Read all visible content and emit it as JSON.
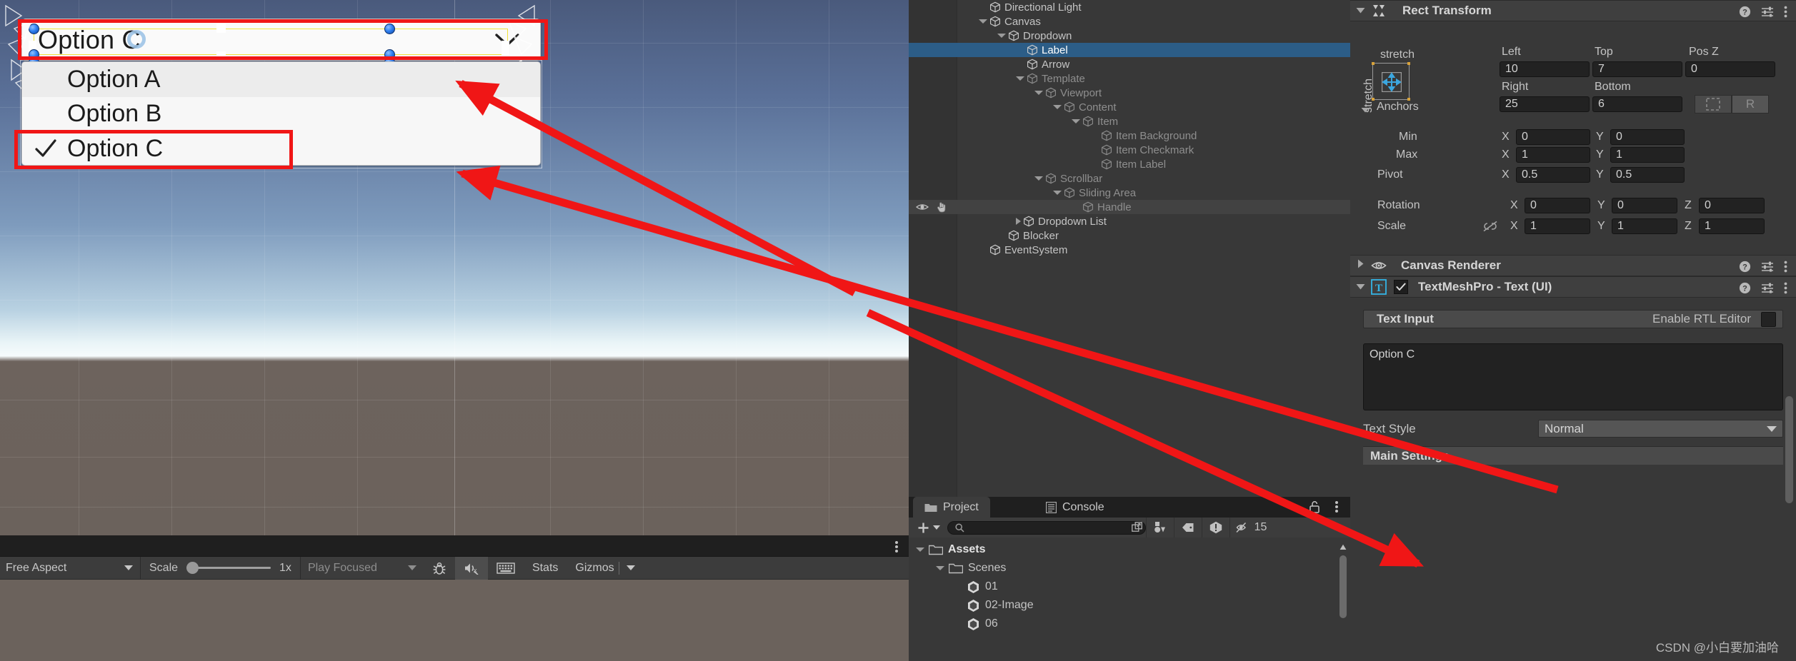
{
  "game_view": {
    "dropdown": {
      "selected_label": "Option C",
      "arrow_icon": "chevron-down-icon",
      "items": [
        {
          "label": "Option A",
          "checked": false
        },
        {
          "label": "Option B",
          "checked": false
        },
        {
          "label": "Option C",
          "checked": true
        }
      ]
    },
    "toolbar": {
      "aspect_label": "Free Aspect",
      "scale_label": "Scale",
      "scale_value": "1x",
      "play_mode_label": "Play Focused",
      "stats_label": "Stats",
      "gizmos_label": "Gizmos",
      "mute_icon": "mute-audio-icon",
      "debug_icon": "bug-icon",
      "keyboard_icon": "keyboard-icon",
      "kebab_icon": "kebab-menu-icon"
    }
  },
  "hierarchy": {
    "rows": [
      {
        "label": "Directional Light",
        "indent": 1,
        "toggle": "none",
        "dim": false,
        "state": "normal"
      },
      {
        "label": "Canvas",
        "indent": 1,
        "toggle": "open",
        "dim": false,
        "state": "normal"
      },
      {
        "label": "Dropdown",
        "indent": 2,
        "toggle": "open",
        "dim": false,
        "state": "normal"
      },
      {
        "label": "Label",
        "indent": 3,
        "toggle": "none",
        "dim": false,
        "state": "selected"
      },
      {
        "label": "Arrow",
        "indent": 3,
        "toggle": "none",
        "dim": false,
        "state": "normal"
      },
      {
        "label": "Template",
        "indent": 3,
        "toggle": "open",
        "dim": true,
        "state": "normal"
      },
      {
        "label": "Viewport",
        "indent": 4,
        "toggle": "open",
        "dim": true,
        "state": "normal"
      },
      {
        "label": "Content",
        "indent": 5,
        "toggle": "open",
        "dim": true,
        "state": "normal"
      },
      {
        "label": "Item",
        "indent": 6,
        "toggle": "open",
        "dim": true,
        "state": "normal"
      },
      {
        "label": "Item Background",
        "indent": 7,
        "toggle": "none",
        "dim": true,
        "state": "normal"
      },
      {
        "label": "Item Checkmark",
        "indent": 7,
        "toggle": "none",
        "dim": true,
        "state": "normal"
      },
      {
        "label": "Item Label",
        "indent": 7,
        "toggle": "none",
        "dim": true,
        "state": "normal"
      },
      {
        "label": "Scrollbar",
        "indent": 4,
        "toggle": "open",
        "dim": true,
        "state": "normal"
      },
      {
        "label": "Sliding Area",
        "indent": 5,
        "toggle": "open",
        "dim": true,
        "state": "normal"
      },
      {
        "label": "Handle",
        "indent": 6,
        "toggle": "none",
        "dim": true,
        "state": "hovered"
      },
      {
        "label": "Dropdown List",
        "indent": 3,
        "toggle": "closed",
        "dim": false,
        "state": "normal"
      },
      {
        "label": "Blocker",
        "indent": 2,
        "toggle": "none",
        "dim": false,
        "state": "normal"
      },
      {
        "label": "EventSystem",
        "indent": 1,
        "toggle": "none",
        "dim": false,
        "state": "normal"
      }
    ],
    "hovered_row_icons": {
      "eye": "eye-icon",
      "hand": "hand-pointer-icon"
    }
  },
  "project": {
    "tabs": [
      {
        "label": "Project",
        "icon": "folder-icon",
        "active": true
      },
      {
        "label": "Console",
        "icon": "console-icon",
        "active": false
      }
    ],
    "lock_icon": "lock-open-icon",
    "kebab_icon": "kebab-menu-icon",
    "add_label": "+",
    "search_placeholder": "",
    "search_value": "",
    "search_icon": "search-icon",
    "tool_icons": [
      "open-in-new-icon",
      "asset-filter-icon",
      "label-filter-icon",
      "warning-filter-icon",
      "hidden-count-icon"
    ],
    "hidden_count": "15",
    "tree": [
      {
        "label": "Assets",
        "indent": 0,
        "toggle": "open",
        "icon": "folder-open-icon",
        "bold": true
      },
      {
        "label": "Scenes",
        "indent": 1,
        "toggle": "open",
        "icon": "folder-open-icon",
        "bold": false
      },
      {
        "label": "01",
        "indent": 2,
        "toggle": "none",
        "icon": "unity-scene-icon",
        "bold": false
      },
      {
        "label": "02-Image",
        "indent": 2,
        "toggle": "none",
        "icon": "unity-scene-icon",
        "bold": false
      },
      {
        "label": "06",
        "indent": 2,
        "toggle": "none",
        "icon": "unity-scene-icon",
        "bold": false
      }
    ]
  },
  "inspector": {
    "rect_transform": {
      "title": "Rect Transform",
      "icon": "rect-transform-icon",
      "help_icon": "help-icon",
      "preset_icon": "preset-icon",
      "kebab_icon": "kebab-menu-icon",
      "anchor_preset_label": "stretch",
      "anchor_preset_label_vertical": "stretch",
      "left_label": "Left",
      "left_value": "10",
      "top_label": "Top",
      "top_value": "7",
      "posz_label": "Pos Z",
      "posz_value": "0",
      "right_label": "Right",
      "right_value": "25",
      "bottom_label": "Bottom",
      "bottom_value": "6",
      "blueprint_icon": "blueprint-mode-icon",
      "raw_edit_label": "R",
      "anchors_label": "Anchors",
      "min_label": "Min",
      "min_x": "0",
      "min_y": "0",
      "max_label": "Max",
      "max_x": "1",
      "max_y": "1",
      "pivot_label": "Pivot",
      "pivot_x": "0.5",
      "pivot_y": "0.5",
      "rotation_label": "Rotation",
      "rot_x": "0",
      "rot_y": "0",
      "rot_z": "0",
      "scale_label": "Scale",
      "scale_link_icon": "link-off-icon",
      "scale_x": "1",
      "scale_y": "1",
      "scale_z": "1",
      "x_axis": "X",
      "y_axis": "Y",
      "z_axis": "Z"
    },
    "canvas_renderer": {
      "title": "Canvas Renderer",
      "eye_icon": "eye-icon",
      "help_icon": "help-icon",
      "preset_icon": "preset-icon",
      "kebab_icon": "kebab-menu-icon"
    },
    "tmp_text": {
      "title": "TextMeshPro - Text (UI)",
      "component_icon": "tmp-text-icon",
      "enabled": true,
      "help_icon": "help-icon",
      "preset_icon": "preset-icon",
      "kebab_icon": "kebab-menu-icon",
      "text_input_label": "Text Input",
      "rtl_label": "Enable RTL Editor",
      "rtl_checked": false,
      "text_value": "Option C",
      "text_style_label": "Text Style",
      "text_style_value": "Normal",
      "main_settings_label": "Main Settings"
    }
  },
  "watermark": "CSDN @小白要加油哈",
  "colors": {
    "accent_selection": "#2c5d87",
    "annotation_red": "#f01616",
    "panel_bg": "#383838",
    "field_bg": "#222222",
    "tmp_icon_blue": "#33b5e5"
  }
}
